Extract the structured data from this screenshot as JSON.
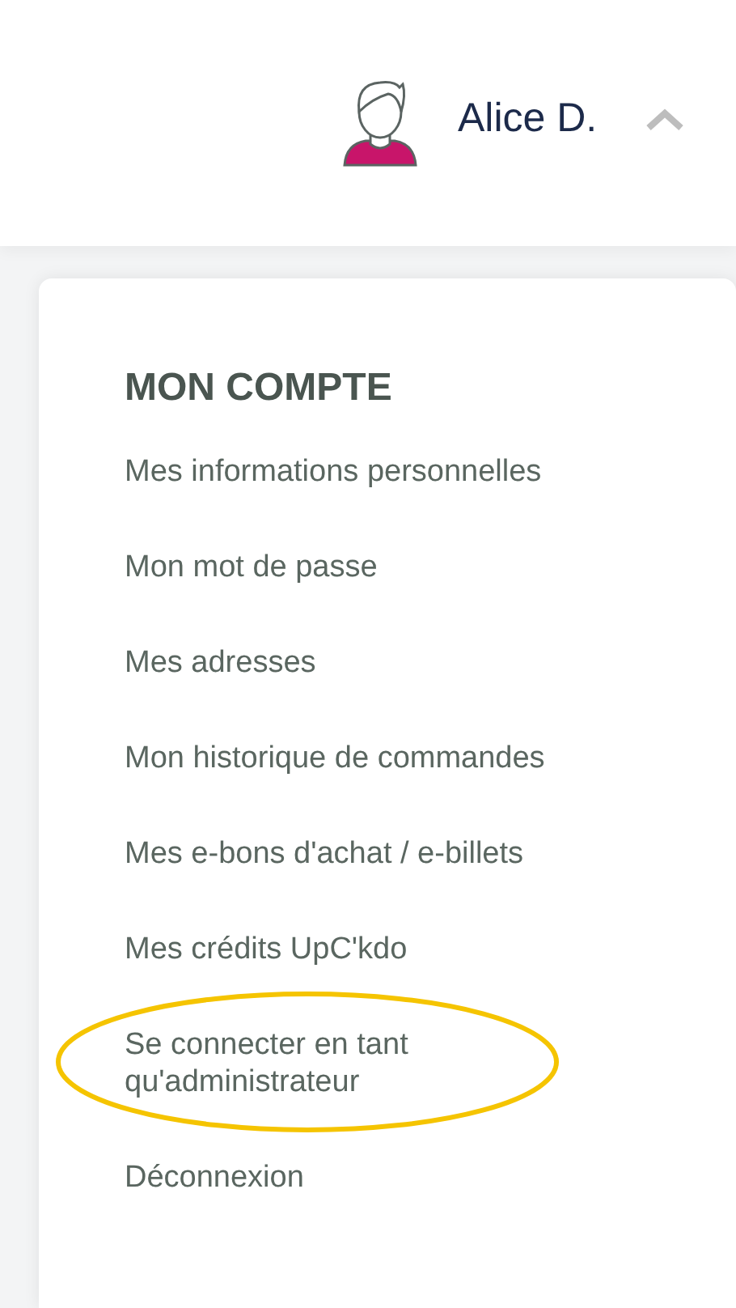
{
  "header": {
    "user_name": "Alice D.",
    "menu_expanded": true
  },
  "account_menu": {
    "title": "MON COMPTE",
    "items": [
      {
        "label": "Mes informations personnelles",
        "highlighted": false
      },
      {
        "label": "Mon mot de passe",
        "highlighted": false
      },
      {
        "label": "Mes adresses",
        "highlighted": false
      },
      {
        "label": "Mon historique de commandes",
        "highlighted": false
      },
      {
        "label": "Mes e-bons d'achat / e-billets",
        "highlighted": false
      },
      {
        "label": "Mes crédits UpC'kdo",
        "highlighted": false
      },
      {
        "label": "Se connecter en tant qu'administrateur",
        "highlighted": true
      },
      {
        "label": "Déconnexion",
        "highlighted": false
      }
    ]
  }
}
